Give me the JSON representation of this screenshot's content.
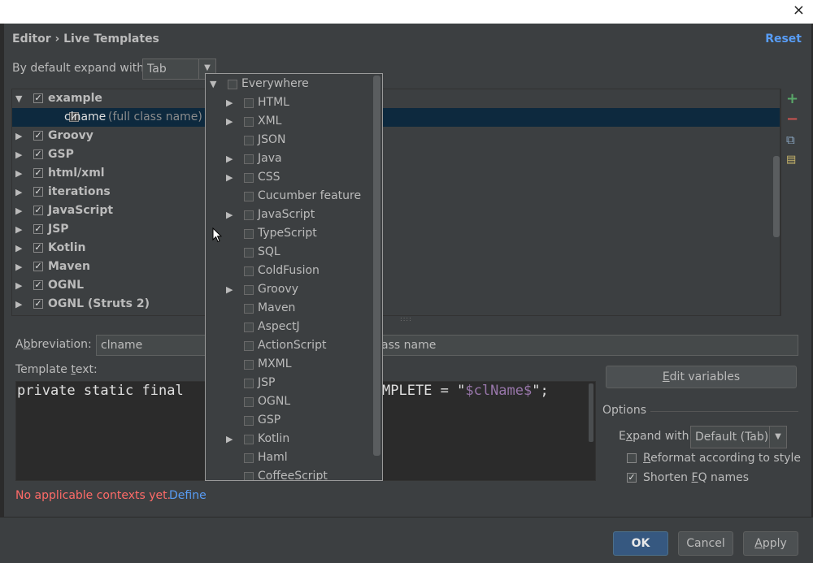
{
  "window": {
    "close_glyph": "×"
  },
  "header": {
    "breadcrumb": "Editor › Live Templates",
    "reset_label": "Reset"
  },
  "expand": {
    "label": "By default expand with",
    "value": "Tab"
  },
  "tree": {
    "groups": [
      {
        "name": "example",
        "checked": true,
        "expanded": true
      },
      {
        "name": "clname",
        "desc": "(full class name)",
        "checked": true,
        "child": true,
        "selected": true
      },
      {
        "name": "Groovy",
        "checked": true
      },
      {
        "name": "GSP",
        "checked": true
      },
      {
        "name": "html/xml",
        "checked": true
      },
      {
        "name": "iterations",
        "checked": true
      },
      {
        "name": "JavaScript",
        "checked": true
      },
      {
        "name": "JSP",
        "checked": true
      },
      {
        "name": "Kotlin",
        "checked": true
      },
      {
        "name": "Maven",
        "checked": true
      },
      {
        "name": "OGNL",
        "checked": true
      },
      {
        "name": "OGNL (Struts 2)",
        "checked": true
      }
    ]
  },
  "toolbar": {
    "add_icon": "plus-icon",
    "remove_icon": "minus-icon",
    "copy_icon": "copy-icon",
    "notes_icon": "notes-icon"
  },
  "abbreviation": {
    "label_pre": "A",
    "label_ul": "b",
    "label_post": "breviation:",
    "value": "clname",
    "description_value": "ass name"
  },
  "template": {
    "label_pre": "Template ",
    "label_ul": "t",
    "label_post": "ext:",
    "code_left": "private static final",
    "code_right_plain": "MPLETE = \"",
    "code_var": "$clName$",
    "code_end": "\";",
    "edit_variables_pre": "",
    "edit_variables_ul": "E",
    "edit_variables_post": "dit variables"
  },
  "options": {
    "title": "Options",
    "expand_label_pre": "E",
    "expand_label_ul": "x",
    "expand_label_post": "pand with",
    "expand_value": "Default (Tab)",
    "reformat_pre": "",
    "reformat_ul": "R",
    "reformat_post": "eformat according to style",
    "reformat_checked": false,
    "shorten_pre": "Shorten ",
    "shorten_ul": "F",
    "shorten_post": "Q names",
    "shorten_checked": true
  },
  "contexts": {
    "warning": "No applicable contexts yet.",
    "define_label": "Define"
  },
  "popup": {
    "items": [
      {
        "label": "Everywhere",
        "level": 0,
        "arrow": "down"
      },
      {
        "label": "HTML",
        "level": 1,
        "arrow": "right"
      },
      {
        "label": "XML",
        "level": 1,
        "arrow": "right"
      },
      {
        "label": "JSON",
        "level": 1
      },
      {
        "label": "Java",
        "level": 1,
        "arrow": "right"
      },
      {
        "label": "CSS",
        "level": 1,
        "arrow": "right"
      },
      {
        "label": "Cucumber feature",
        "level": 1
      },
      {
        "label": "JavaScript",
        "level": 1,
        "arrow": "right"
      },
      {
        "label": "TypeScript",
        "level": 1
      },
      {
        "label": "SQL",
        "level": 1
      },
      {
        "label": "ColdFusion",
        "level": 1
      },
      {
        "label": "Groovy",
        "level": 1,
        "arrow": "right"
      },
      {
        "label": "Maven",
        "level": 1
      },
      {
        "label": "AspectJ",
        "level": 1
      },
      {
        "label": "ActionScript",
        "level": 1
      },
      {
        "label": "MXML",
        "level": 1
      },
      {
        "label": "JSP",
        "level": 1
      },
      {
        "label": "OGNL",
        "level": 1
      },
      {
        "label": "GSP",
        "level": 1
      },
      {
        "label": "Kotlin",
        "level": 1,
        "arrow": "right"
      },
      {
        "label": "Haml",
        "level": 1
      },
      {
        "label": "CoffeeScript",
        "level": 1
      }
    ]
  },
  "footer": {
    "ok_label": "OK",
    "cancel_label": "Cancel",
    "apply_pre": "",
    "apply_ul": "A",
    "apply_post": "pply"
  },
  "colors": {
    "accent": "#589df6",
    "error": "#ff6b68",
    "selection": "#0d293e",
    "add": "#59a869",
    "remove": "#c75450"
  }
}
